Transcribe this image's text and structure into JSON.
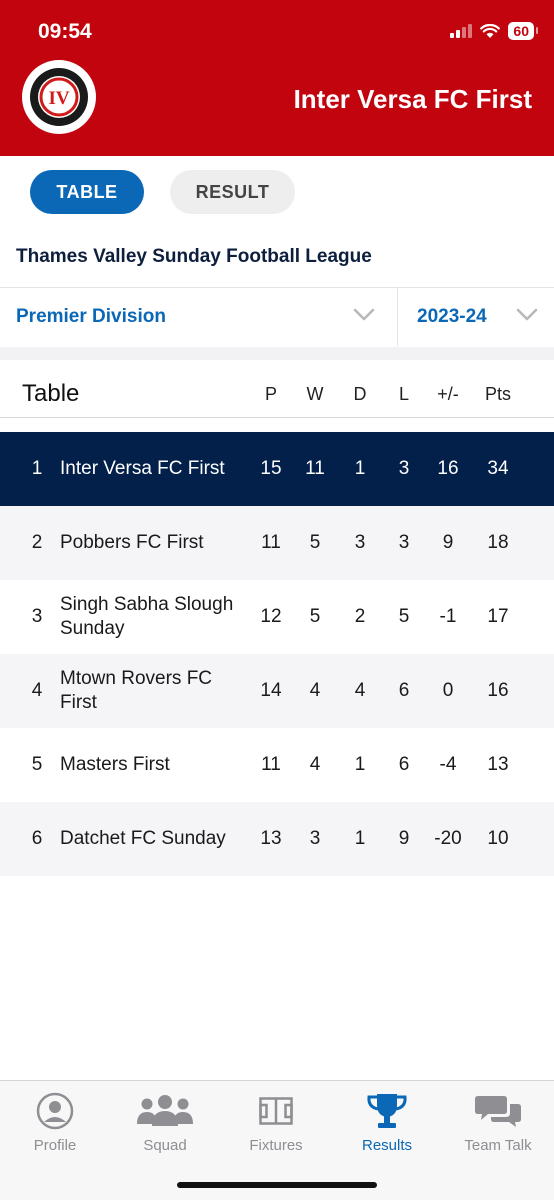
{
  "status_bar": {
    "time": "09:54",
    "battery": "60"
  },
  "header": {
    "title": "Inter Versa FC First",
    "logo_text": "IV"
  },
  "segments": {
    "table_label": "TABLE",
    "result_label": "RESULT"
  },
  "league": "Thames Valley Sunday Football League",
  "filters": {
    "division": "Premier Division",
    "season": "2023-24"
  },
  "table": {
    "title": "Table",
    "columns": {
      "p": "P",
      "w": "W",
      "d": "D",
      "l": "L",
      "gd": "+/-",
      "pts": "Pts"
    },
    "rows": [
      {
        "pos": "1",
        "name": "Inter Versa FC First",
        "p": "15",
        "w": "11",
        "d": "1",
        "l": "3",
        "gd": "16",
        "pts": "34"
      },
      {
        "pos": "2",
        "name": "Pobbers FC First",
        "p": "11",
        "w": "5",
        "d": "3",
        "l": "3",
        "gd": "9",
        "pts": "18"
      },
      {
        "pos": "3",
        "name": "Singh Sabha Slough Sunday",
        "p": "12",
        "w": "5",
        "d": "2",
        "l": "5",
        "gd": "-1",
        "pts": "17"
      },
      {
        "pos": "4",
        "name": "Mtown Rovers FC First",
        "p": "14",
        "w": "4",
        "d": "4",
        "l": "6",
        "gd": "0",
        "pts": "16"
      },
      {
        "pos": "5",
        "name": "Masters First",
        "p": "11",
        "w": "4",
        "d": "1",
        "l": "6",
        "gd": "-4",
        "pts": "13"
      },
      {
        "pos": "6",
        "name": "Datchet FC Sunday",
        "p": "13",
        "w": "3",
        "d": "1",
        "l": "9",
        "gd": "-20",
        "pts": "10"
      }
    ]
  },
  "tabbar": {
    "items": [
      {
        "label": "Profile",
        "icon": "profile-icon"
      },
      {
        "label": "Squad",
        "icon": "squad-icon"
      },
      {
        "label": "Fixtures",
        "icon": "fixtures-icon"
      },
      {
        "label": "Results",
        "icon": "trophy-icon"
      },
      {
        "label": "Team Talk",
        "icon": "chat-icon"
      }
    ],
    "active": "Results"
  },
  "colors": {
    "brand_red": "#c2040e",
    "accent_blue": "#0b68b6",
    "highlight_navy": "#03204a"
  }
}
